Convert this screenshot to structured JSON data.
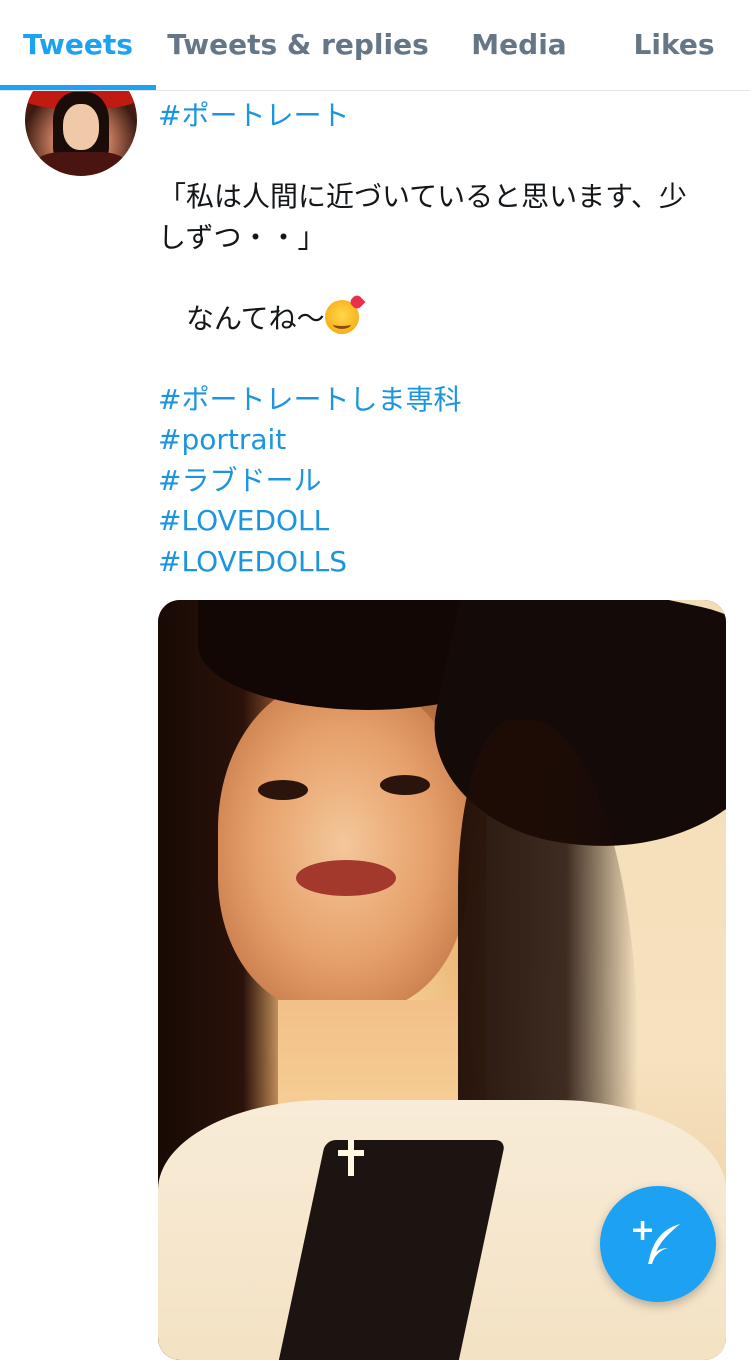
{
  "tabs": [
    {
      "label": "Tweets",
      "active": true
    },
    {
      "label": "Tweets & replies",
      "active": false
    },
    {
      "label": "Media",
      "active": false
    },
    {
      "label": "Likes",
      "active": false
    }
  ],
  "tweet": {
    "hashtag_top": "#ポートレート",
    "text_line1": "「私は人間に近づいていると思います、少",
    "text_line2": "しずつ・・」",
    "text_line3": "　なんてね〜",
    "emoji": "smiling-face-with-hearts",
    "hashtags": [
      "#ポートレートしま専科",
      "#portrait",
      "#ラブドール",
      "#LOVEDOLL",
      "#LOVEDOLLS"
    ]
  },
  "compose_button": {
    "icon": "compose-feather-icon",
    "plus": "+"
  },
  "colors": {
    "accent": "#1da1f2",
    "hashtag": "#1b95e0",
    "inactive_tab": "#657786",
    "text": "#14171a"
  }
}
